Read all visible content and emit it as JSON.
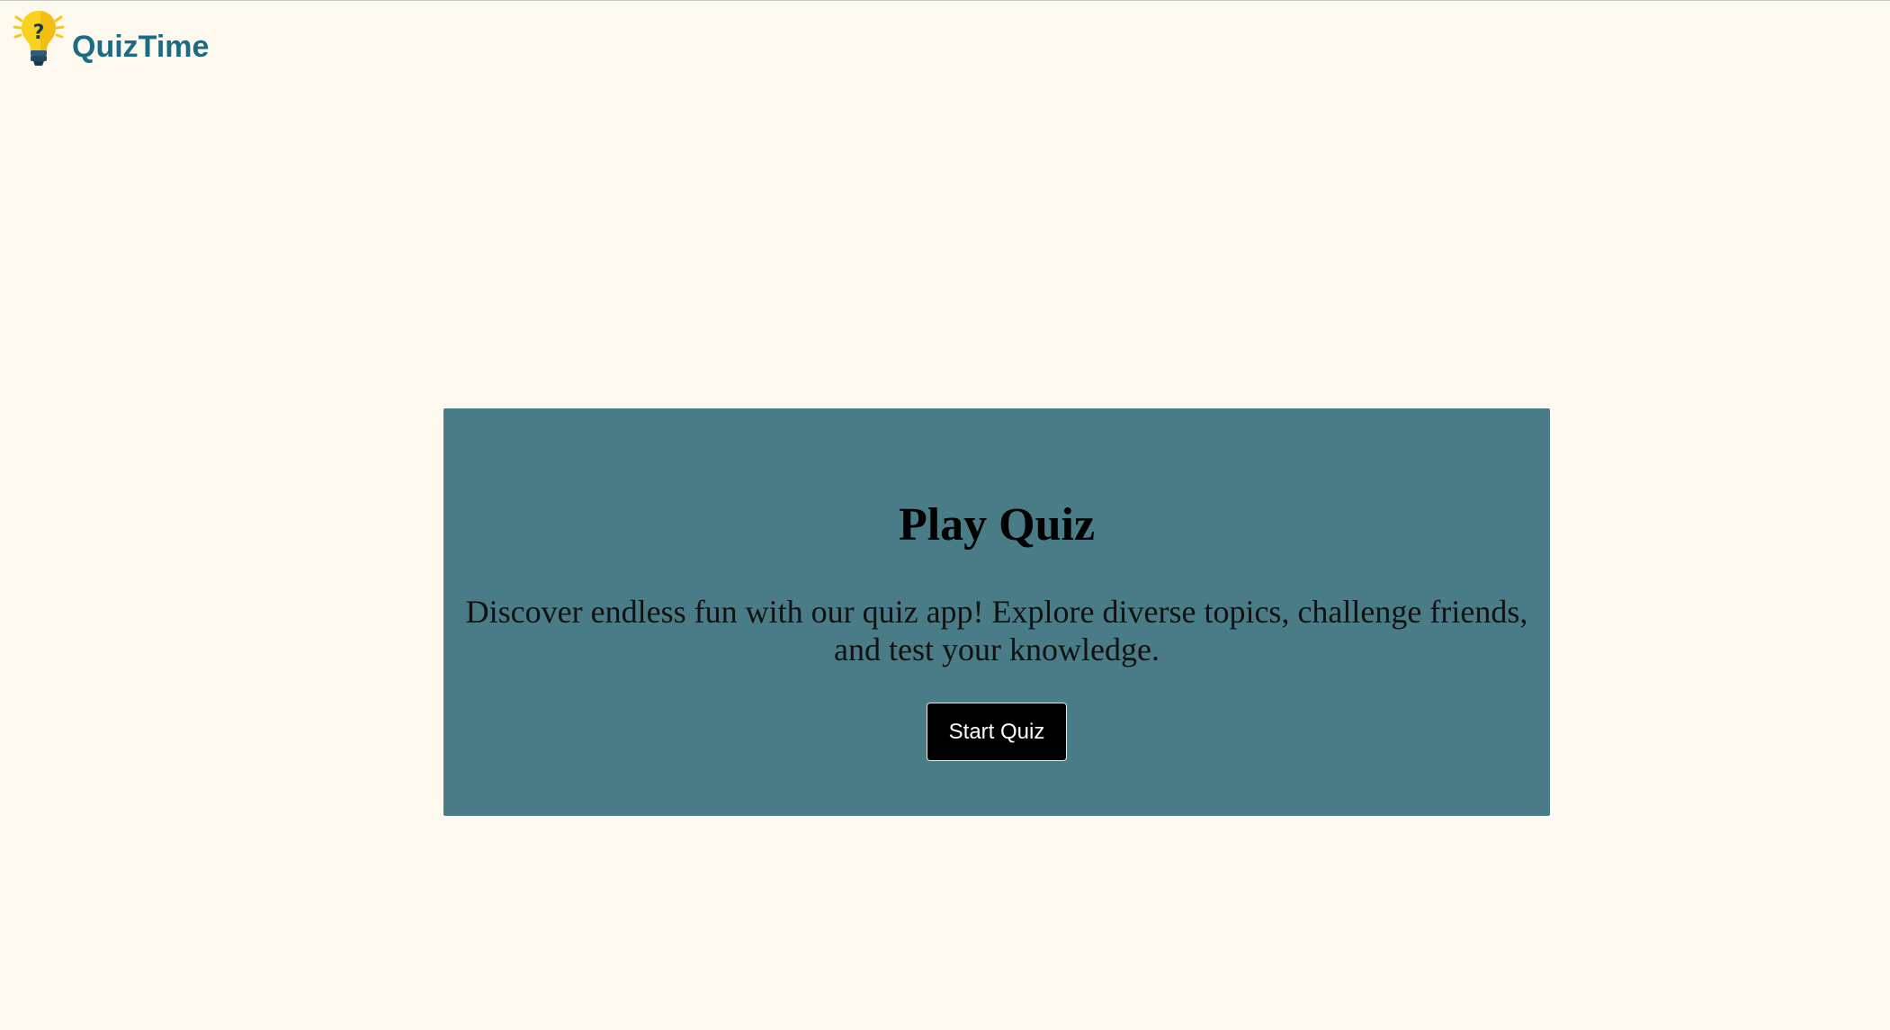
{
  "brand": {
    "name": "QuizTime",
    "logo_icon": "lightbulb-question-icon",
    "name_color": "#1a6b85"
  },
  "hero": {
    "title": "Play Quiz",
    "description": "Discover endless fun with our quiz app! Explore diverse topics, challenge friends, and test your knowledge.",
    "start_button_label": "Start Quiz",
    "card_color": "#4a7c87",
    "button_color": "#000000"
  },
  "page": {
    "background_color": "#fef9ee"
  }
}
